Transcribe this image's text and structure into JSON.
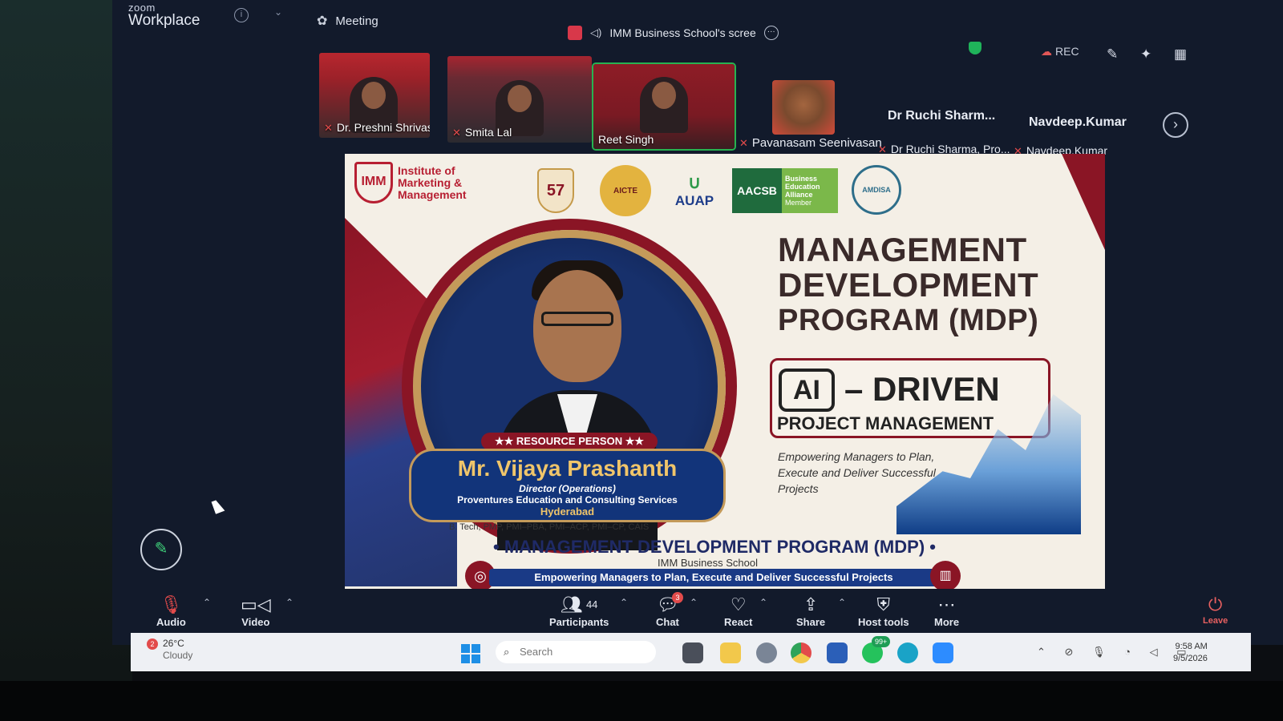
{
  "app": {
    "brand_small": "zoom",
    "brand_name": "Workplace",
    "meeting_tab": "Meeting",
    "share_banner": "IMM Business School's scree",
    "rec_label": "REC"
  },
  "participants": [
    {
      "name": "Dr. Preshni Shrivastav...",
      "muted": true
    },
    {
      "name": "Smita Lal",
      "muted": true
    },
    {
      "name": "Reet Singh",
      "muted": false,
      "active_speaker": true
    },
    {
      "name": "Pavanasam Seenivasan",
      "muted": true
    },
    {
      "name": "Dr Ruchi Sharma, Pro...",
      "muted": true,
      "header": "Dr Ruchi Sharm..."
    },
    {
      "name": "Navdeep.Kumar",
      "muted": true,
      "header": "Navdeep.Kumar"
    }
  ],
  "slide": {
    "institute": "Institute of Marketing & Management",
    "badge_57": "57",
    "accreditations": [
      "AICTE",
      "AUAP",
      "AACSB",
      "Business Education Alliance",
      "Member",
      "AMDISA"
    ],
    "title_line1": "MANAGEMENT",
    "title_line2": "DEVELOPMENT",
    "title_line3": "PROGRAM (MDP)",
    "ai_label": "AI",
    "driven": "– DRIVEN",
    "project_mgmt": "PROJECT MANAGEMENT",
    "tagline": "Empowering Managers to Plan, Execute and Deliver Successful Projects",
    "resource_tag": "★★ RESOURCE PERSON ★★",
    "speaker_name": "Mr. Vijaya Prashanth",
    "speaker_role": "Director (Operations)",
    "speaker_org": "Proventures Education and Consulting Services",
    "speaker_city": "Hyderabad",
    "speaker_creds": "B. Tech, PMP, PMI–PBA, PMI–ACP, PMI–CP, CAIS",
    "bottom_title": "• MANAGEMENT DEVELOPMENT PROGRAM (MDP) •",
    "bottom_school": "IMM Business School",
    "bottom_bar": "Empowering Managers to Plan, Execute and Deliver Successful Projects"
  },
  "toolbar": {
    "audio": "Audio",
    "video": "Video",
    "participants": "Participants",
    "participant_count": "44",
    "chat": "Chat",
    "chat_badge": "3",
    "react": "React",
    "share": "Share",
    "host_tools": "Host tools",
    "more": "More",
    "leave": "Leave"
  },
  "taskbar": {
    "weather_temp": "26°C",
    "weather_cond": "Cloudy",
    "weather_alert": "2",
    "search_placeholder": "Search",
    "whatsapp_badge": "99+",
    "time": "9:58 AM",
    "date": "9/5/2026"
  },
  "colors": {
    "zoom_bg": "#121a2b",
    "active_speaker": "#27b351",
    "muted_mic": "#e24b4b",
    "slide_maroon": "#8a1525",
    "slide_navy": "#12347a",
    "slide_gold": "#f0c56a"
  }
}
